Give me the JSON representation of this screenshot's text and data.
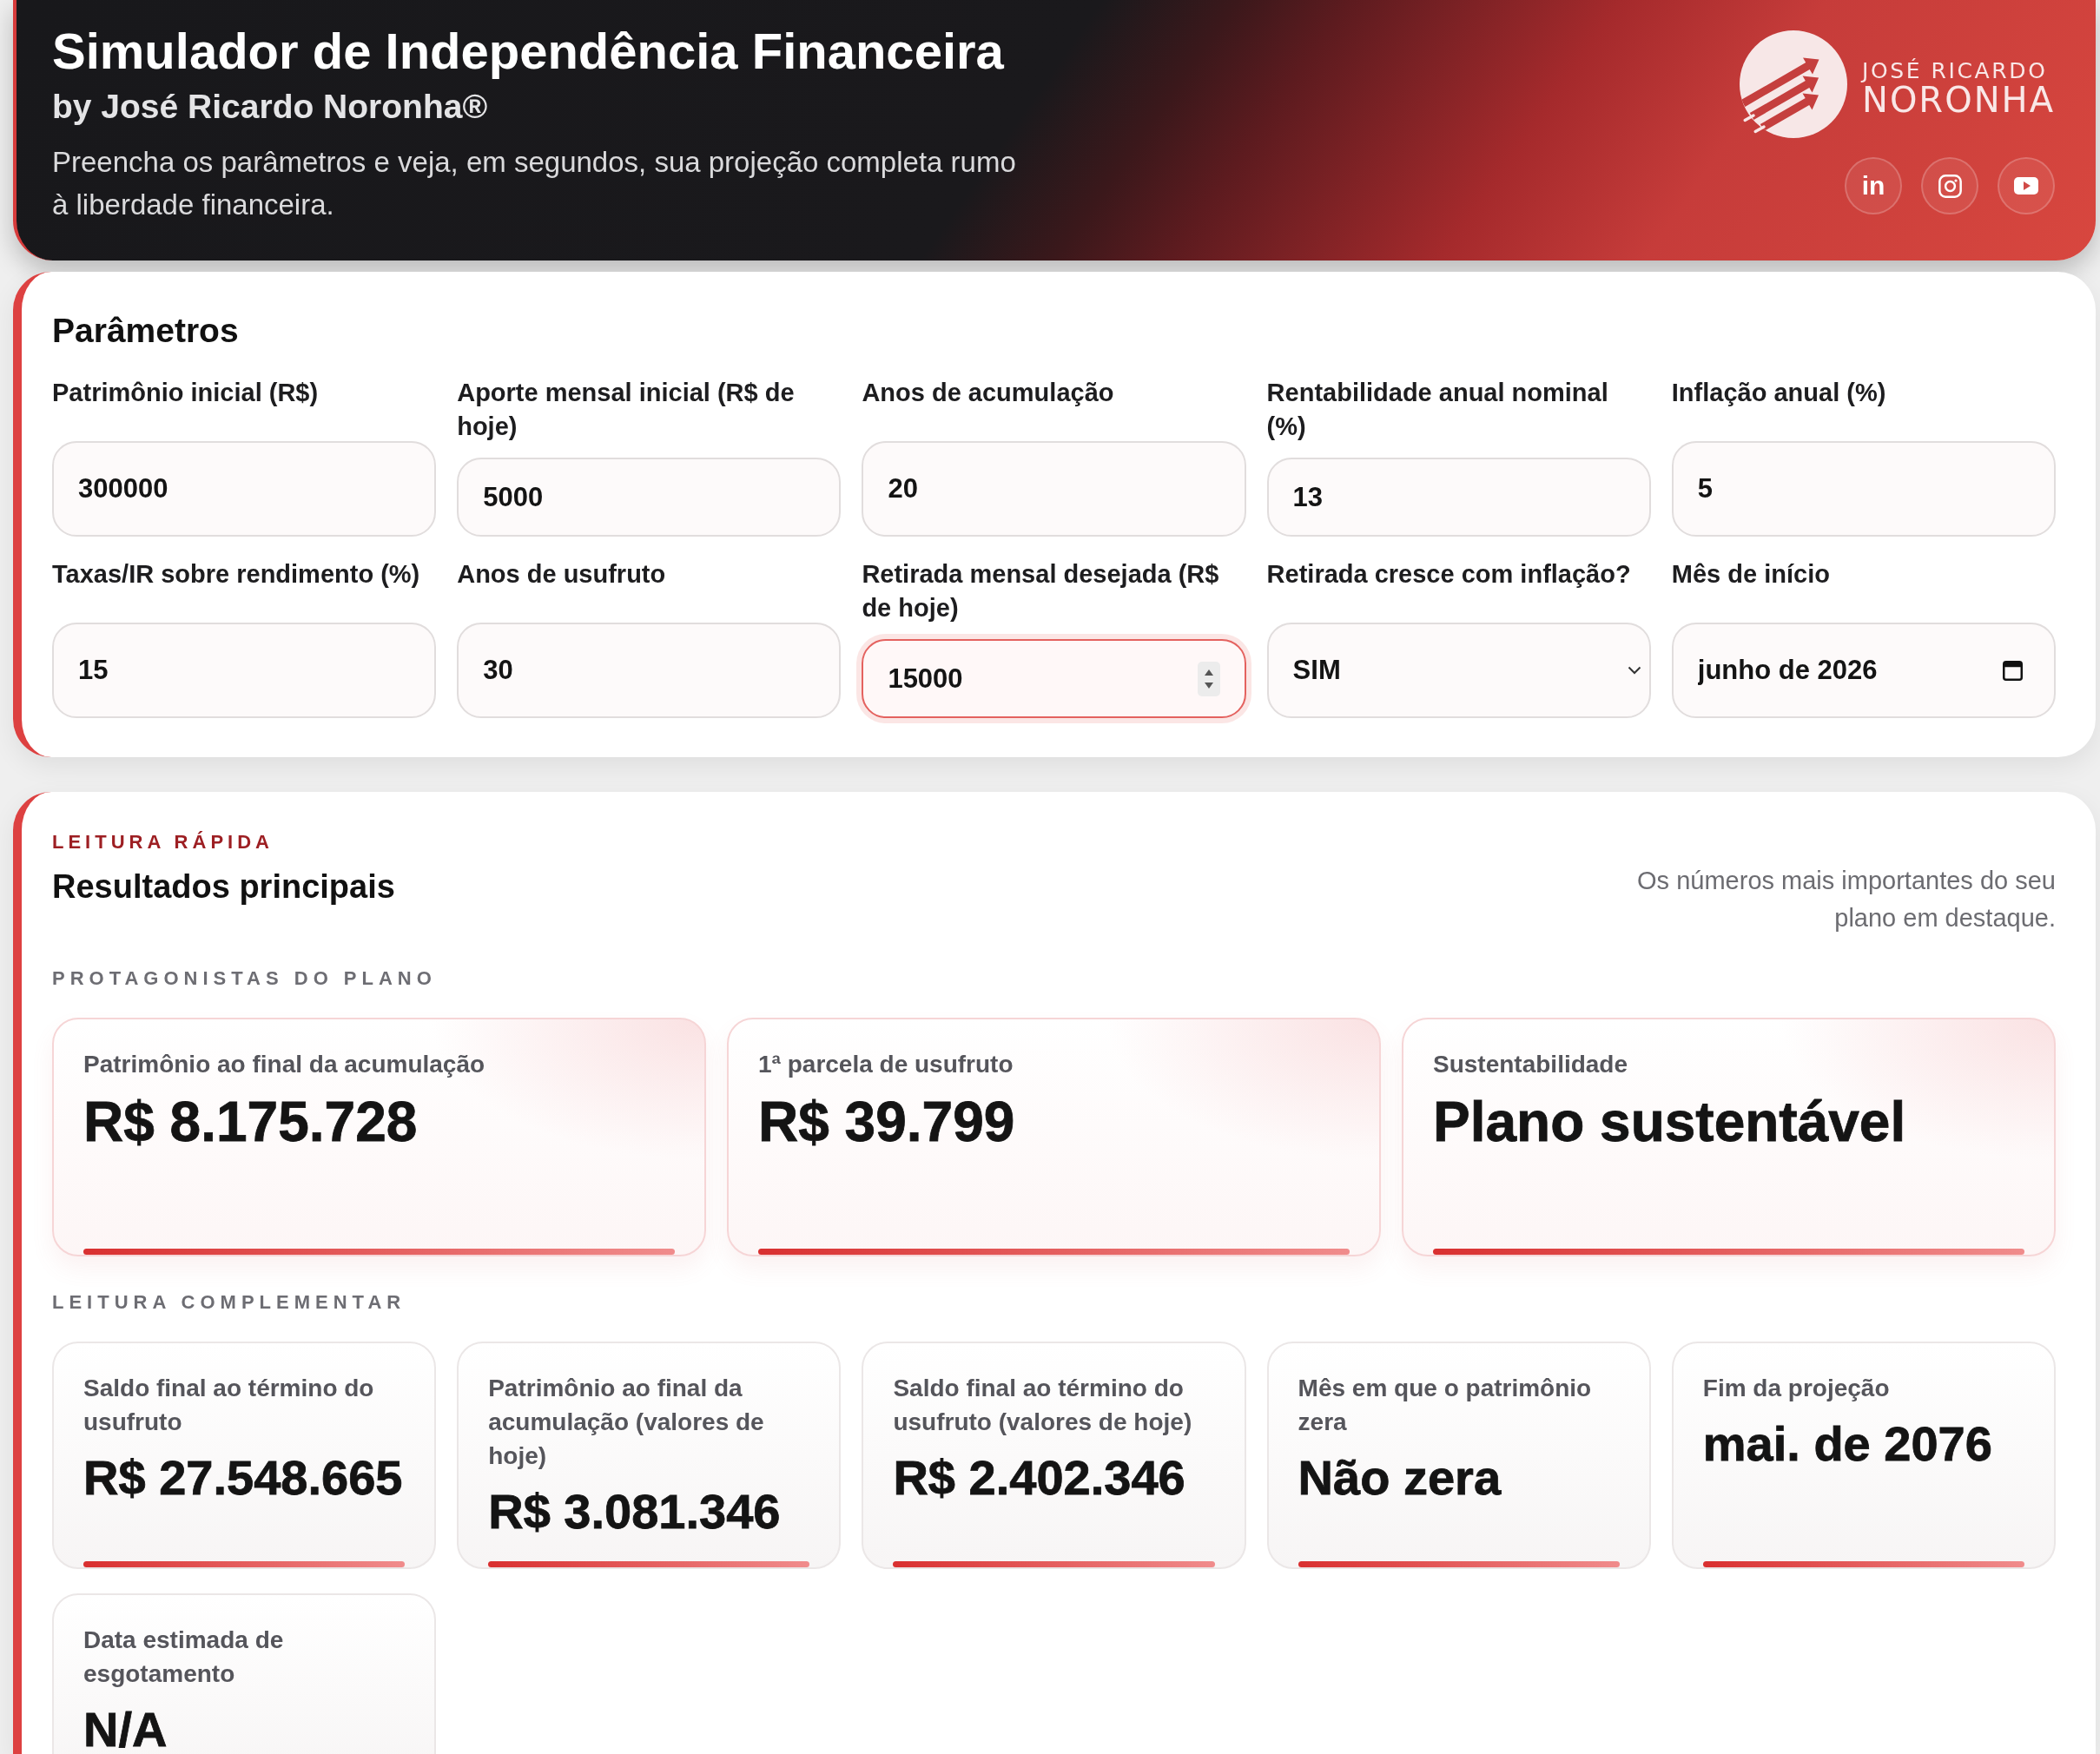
{
  "header": {
    "title": "Simulador de Independência Financeira",
    "byline": "by José Ricardo Noronha®",
    "description": "Preencha os parâmetros e veja, em segundos, sua projeção completa rumo à liberdade financeira.",
    "logo": {
      "line_1": "JOSÉ RICARDO",
      "line_2": "NORONHA"
    },
    "social_links": [
      {
        "kind": "linkedin",
        "glyph": "in"
      },
      {
        "kind": "instagram"
      },
      {
        "kind": "youtube"
      }
    ]
  },
  "parameters": {
    "title": "Parâmetros",
    "fields": [
      {
        "label": "Patrimônio inicial (R$)",
        "value": "300000",
        "kind": "number",
        "focused": false
      },
      {
        "label": "Aporte mensal inicial (R$ de hoje)",
        "value": "5000",
        "kind": "number",
        "focused": false
      },
      {
        "label": "Anos de acumulação",
        "value": "20",
        "kind": "number",
        "focused": false
      },
      {
        "label": "Rentabilidade anual nominal (%)",
        "value": "13",
        "kind": "number",
        "focused": false
      },
      {
        "label": "Inflação anual (%)",
        "value": "5",
        "kind": "number",
        "focused": false
      },
      {
        "label": "Taxas/IR sobre rendimento (%)",
        "value": "15",
        "kind": "number",
        "focused": false
      },
      {
        "label": "Anos de usufruto",
        "value": "30",
        "kind": "number",
        "focused": false
      },
      {
        "label": "Retirada mensal desejada (R$ de hoje)",
        "value": "15000",
        "kind": "number",
        "focused": true
      },
      {
        "label": "Retirada cresce com inflação?",
        "value": "SIM",
        "kind": "select",
        "focused": false
      },
      {
        "label": "Mês de início",
        "value": "junho de 2026",
        "kind": "month",
        "focused": false
      }
    ]
  },
  "results": {
    "eyebrow": "LEITURA RÁPIDA",
    "title": "Resultados principais",
    "note": "Os números mais importantes do seu plano em destaque.",
    "groups": [
      {
        "kind": "highlight",
        "heading": "PROTAGONISTAS DO PLANO",
        "cards": [
          {
            "label": "Patrimônio ao final da acumulação",
            "value": "R$ 8.175.728"
          },
          {
            "label": "1ª parcela de usufruto",
            "value": "R$ 39.799"
          },
          {
            "label": "Sustentabilidade",
            "value": "Plano sustentável"
          }
        ]
      },
      {
        "kind": "complementary",
        "heading": "LEITURA COMPLEMENTAR",
        "cards": [
          {
            "label": "Saldo final ao término do usufruto",
            "value": "R$ 27.548.665"
          },
          {
            "label": "Patrimônio ao final da acumulação (valores de hoje)",
            "value": "R$ 3.081.346"
          },
          {
            "label": "Saldo final ao término do usufruto (valores de hoje)",
            "value": "R$ 2.402.346"
          },
          {
            "label": "Mês em que o patrimônio zera",
            "value": "Não zera"
          },
          {
            "label": "Fim da projeção",
            "value": "mai. de 2076"
          },
          {
            "label": "Data estimada de esgotamento",
            "value": "N/A"
          }
        ]
      }
    ]
  }
}
